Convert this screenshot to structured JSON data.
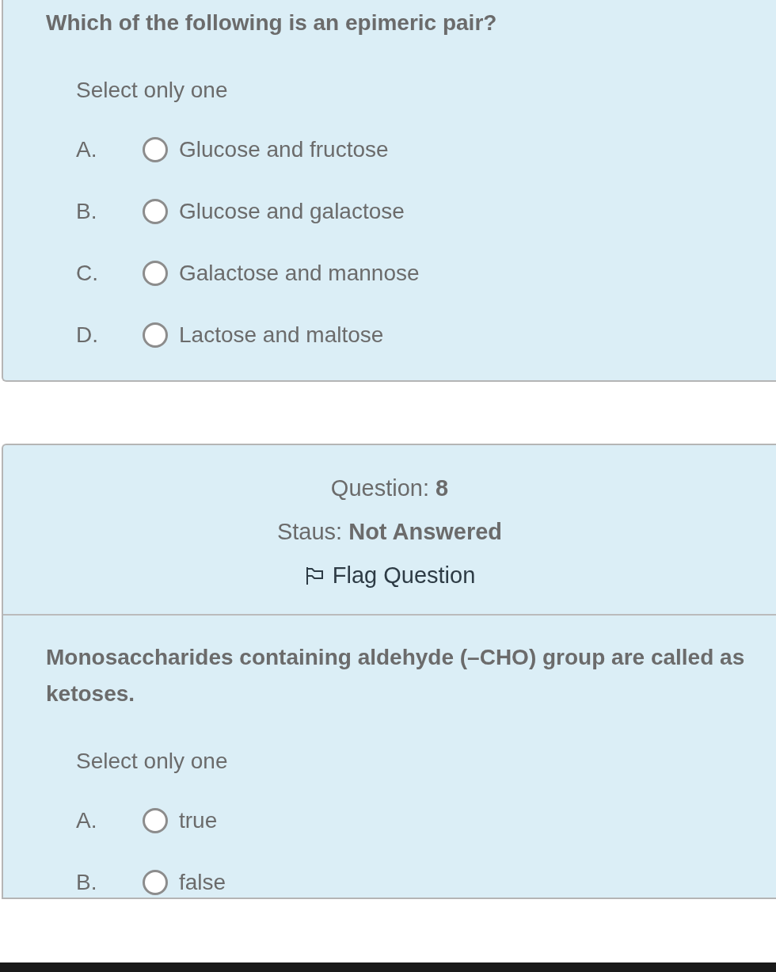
{
  "questions": [
    {
      "kind": "question",
      "text": "Which of the following is an epimeric pair?",
      "instruction": "Select only one",
      "options": [
        {
          "letter": "A.",
          "label": "Glucose and fructose",
          "selected": false
        },
        {
          "letter": "B.",
          "label": "Glucose and galactose",
          "selected": false
        },
        {
          "letter": "C.",
          "label": "Galactose and mannose",
          "selected": false
        },
        {
          "letter": "D.",
          "label": "Lactose and maltose",
          "selected": false
        }
      ]
    },
    {
      "kind": "question",
      "header": {
        "number_label": "Question:",
        "number": "8",
        "status_label": "Staus:",
        "status": "Not Answered",
        "flag": "Flag Question",
        "flagged": false
      },
      "text": "Monosaccharides containing aldehyde (–CHO) group are called as ketoses.",
      "instruction": "Select only one",
      "options": [
        {
          "letter": "A.",
          "label": "true",
          "selected": false
        },
        {
          "letter": "B.",
          "label": "false",
          "selected": false
        }
      ]
    }
  ]
}
